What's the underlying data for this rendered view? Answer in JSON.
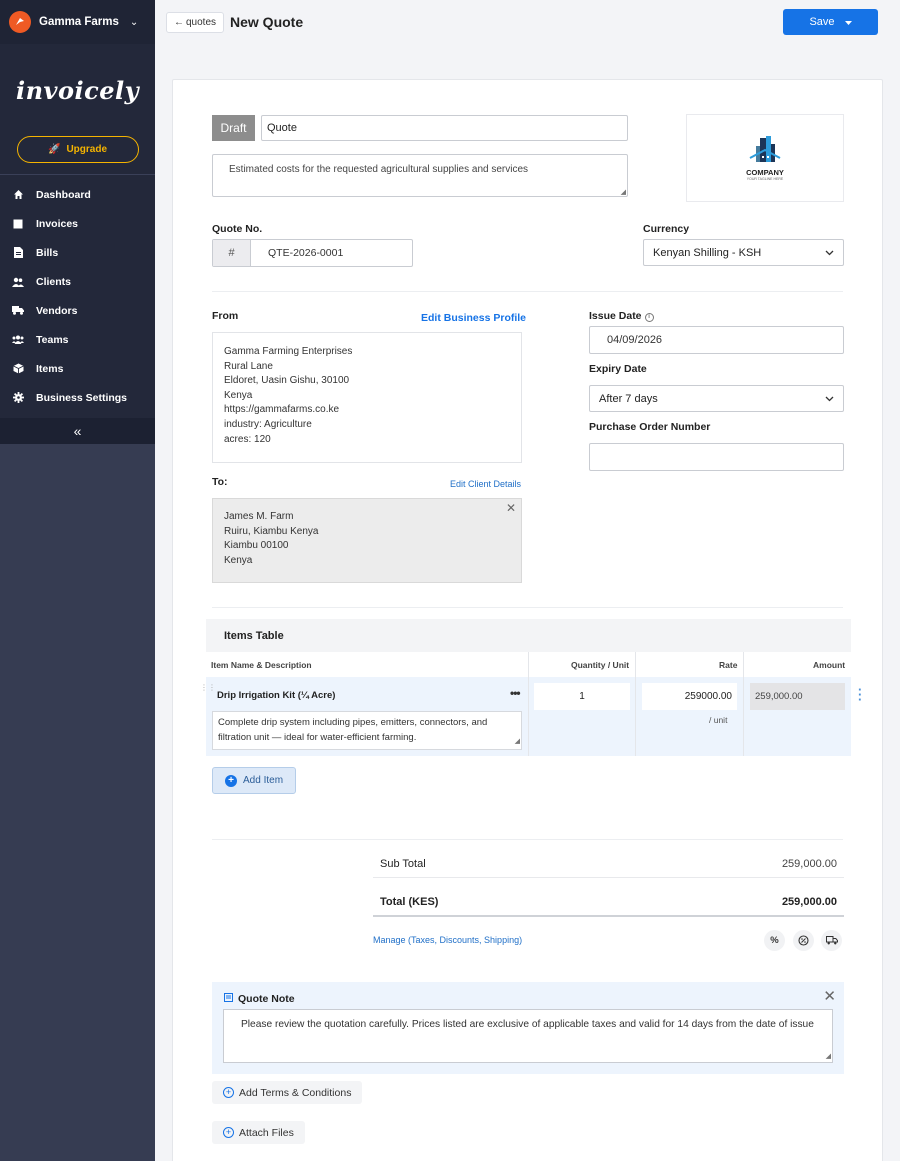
{
  "org": {
    "name": "Gamma Farms"
  },
  "brand": {
    "name": "invoicely"
  },
  "sidebar": {
    "upgrade_label": "Upgrade",
    "items": [
      {
        "label": "Dashboard",
        "icon": "home-icon"
      },
      {
        "label": "Invoices",
        "icon": "invoice-icon"
      },
      {
        "label": "Bills",
        "icon": "bill-icon"
      },
      {
        "label": "Clients",
        "icon": "clients-icon"
      },
      {
        "label": "Vendors",
        "icon": "truck-icon"
      },
      {
        "label": "Teams",
        "icon": "team-icon"
      },
      {
        "label": "Items",
        "icon": "box-icon"
      },
      {
        "label": "Business Settings",
        "icon": "gear-icon"
      }
    ],
    "collapse_glyph": "«"
  },
  "header": {
    "back_label": "quotes",
    "title": "New Quote",
    "save_label": "Save"
  },
  "doc": {
    "status_badge": "Draft",
    "title_value": "Quote",
    "description": "Estimated costs for the requested agricultural supplies and services",
    "logo_text": "COMPANY",
    "logo_subtext": "YOUR TAGLINE HERE"
  },
  "quote_no": {
    "label": "Quote No.",
    "prefix": "#",
    "value": "QTE-2026-0001"
  },
  "currency": {
    "label": "Currency",
    "value": "Kenyan Shilling - KSH"
  },
  "from": {
    "label": "From",
    "edit_label": "Edit Business Profile",
    "lines": [
      "Gamma Farming Enterprises",
      "Rural Lane",
      "Eldoret, Uasin Gishu, 30100",
      "Kenya",
      "https://gammafarms.co.ke",
      "industry: Agriculture",
      "acres: 120"
    ]
  },
  "to": {
    "label": "To:",
    "edit_label": "Edit Client Details",
    "lines": [
      "James M. Farm",
      "Ruiru, Kiambu Kenya",
      "Kiambu 00100",
      "Kenya"
    ]
  },
  "issue_date": {
    "label": "Issue Date",
    "value": "04/09/2026"
  },
  "expiry_date": {
    "label": "Expiry Date",
    "value": "After 7 days"
  },
  "po_number": {
    "label": "Purchase Order Number",
    "value": ""
  },
  "items_table": {
    "title": "Items Table",
    "columns": [
      "Item Name & Description",
      "Quantity / Unit",
      "Rate",
      "Amount"
    ],
    "rows": [
      {
        "name": "Drip Irrigation Kit (¼ Acre)",
        "description": "Complete drip system including pipes, emitters, connectors, and filtration unit — ideal for water-efficient farming.",
        "quantity": "1",
        "rate": "259000.00",
        "rate_unit": "/ unit",
        "amount": "259,000.00"
      }
    ],
    "add_label": "Add Item"
  },
  "totals": {
    "subtotal_label": "Sub Total",
    "subtotal_value": "259,000.00",
    "total_label": "Total (KES)",
    "total_value": "259,000.00",
    "manage_label": "Manage (Taxes, Discounts, Shipping)"
  },
  "note": {
    "title": "Quote Note",
    "text": "Please review the quotation carefully. Prices listed are exclusive of applicable taxes and valid for 14 days from the date of issue"
  },
  "extras": {
    "terms_label": "Add Terms & Conditions",
    "attach_label": "Attach Files"
  },
  "colors": {
    "sidebar_bg": "#363c52",
    "accent": "#1673e6",
    "upgrade": "#f5b400",
    "org_logo": "#ef5a24"
  }
}
